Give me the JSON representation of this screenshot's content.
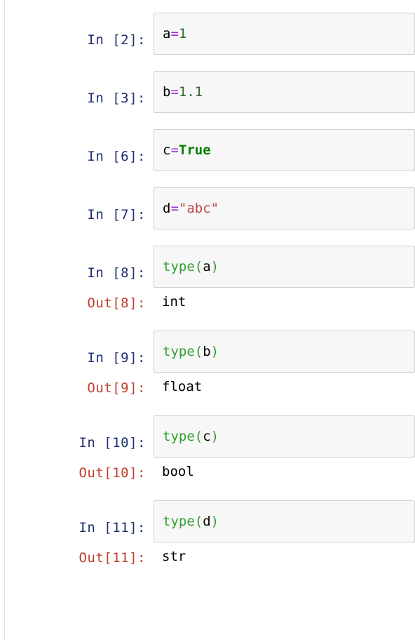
{
  "notebook": {
    "app": "jupyter-notebook",
    "prompt_in_color": "#203070",
    "prompt_out_color": "#bf3e2b",
    "input_bg_color": "#f7f7f7",
    "input_border_color": "#cfcfcf",
    "cells": [
      {
        "prompt_in": "In [2]:",
        "execution_count": 2,
        "source": "a=1",
        "tokens": [
          {
            "t": "a",
            "c": "tok-name"
          },
          {
            "t": "=",
            "c": "tok-op"
          },
          {
            "t": "1",
            "c": "tok-num"
          }
        ],
        "has_output": false
      },
      {
        "prompt_in": "In [3]:",
        "execution_count": 3,
        "source": "b=1.1",
        "tokens": [
          {
            "t": "b",
            "c": "tok-name"
          },
          {
            "t": "=",
            "c": "tok-op"
          },
          {
            "t": "1.1",
            "c": "tok-num"
          }
        ],
        "has_output": false
      },
      {
        "prompt_in": "In [6]:",
        "execution_count": 6,
        "source": "c=True",
        "tokens": [
          {
            "t": "c",
            "c": "tok-name"
          },
          {
            "t": "=",
            "c": "tok-op"
          },
          {
            "t": "True",
            "c": "tok-kw"
          }
        ],
        "has_output": false
      },
      {
        "prompt_in": "In [7]:",
        "execution_count": 7,
        "source": "d=\"abc\"",
        "tokens": [
          {
            "t": "d",
            "c": "tok-name"
          },
          {
            "t": "=",
            "c": "tok-op"
          },
          {
            "t": "\"abc\"",
            "c": "tok-str"
          }
        ],
        "has_output": false
      },
      {
        "prompt_in": "In [8]:",
        "execution_count": 8,
        "source": "type(a)",
        "tokens": [
          {
            "t": "type",
            "c": "tok-builtin"
          },
          {
            "t": "(",
            "c": "tok-punc"
          },
          {
            "t": "a",
            "c": "tok-name"
          },
          {
            "t": ")",
            "c": "tok-punc"
          }
        ],
        "has_output": true,
        "prompt_out": "Out[8]:",
        "output": "int"
      },
      {
        "prompt_in": "In [9]:",
        "execution_count": 9,
        "source": "type(b)",
        "tokens": [
          {
            "t": "type",
            "c": "tok-builtin"
          },
          {
            "t": "(",
            "c": "tok-punc"
          },
          {
            "t": "b",
            "c": "tok-name"
          },
          {
            "t": ")",
            "c": "tok-punc"
          }
        ],
        "has_output": true,
        "prompt_out": "Out[9]:",
        "output": "float"
      },
      {
        "prompt_in": "In [10]:",
        "execution_count": 10,
        "source": "type(c)",
        "tokens": [
          {
            "t": "type",
            "c": "tok-builtin"
          },
          {
            "t": "(",
            "c": "tok-punc"
          },
          {
            "t": "c",
            "c": "tok-name"
          },
          {
            "t": ")",
            "c": "tok-punc"
          }
        ],
        "has_output": true,
        "prompt_out": "Out[10]:",
        "output": "bool"
      },
      {
        "prompt_in": "In [11]:",
        "execution_count": 11,
        "source": "type(d)",
        "tokens": [
          {
            "t": "type",
            "c": "tok-builtin"
          },
          {
            "t": "(",
            "c": "tok-punc"
          },
          {
            "t": "d",
            "c": "tok-name"
          },
          {
            "t": ")",
            "c": "tok-punc"
          }
        ],
        "has_output": true,
        "prompt_out": "Out[11]:",
        "output": "str"
      }
    ]
  }
}
